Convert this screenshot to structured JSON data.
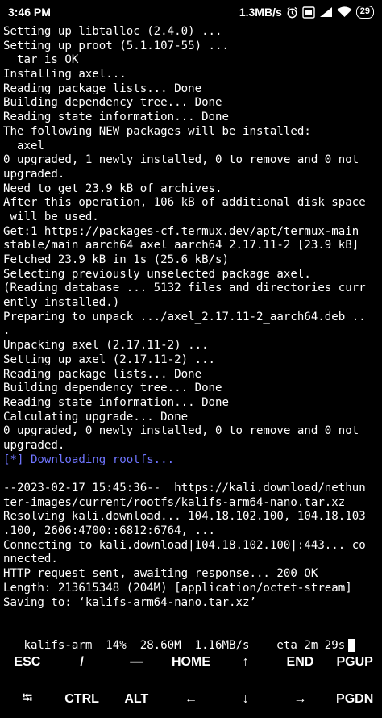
{
  "status_bar": {
    "time": "3:46 PM",
    "speed": "1.3MB/s",
    "battery": "29",
    "icons": [
      "alarm-icon",
      "volte-icon",
      "signal-icon",
      "wifi-icon",
      "battery-icon"
    ]
  },
  "terminal": {
    "lines": [
      {
        "text": "Setting up libtalloc (2.4.0) ..."
      },
      {
        "text": "Setting up proot (5.1.107-55) ..."
      },
      {
        "text": "  tar is OK"
      },
      {
        "text": "Installing axel..."
      },
      {
        "text": "Reading package lists... Done"
      },
      {
        "text": "Building dependency tree... Done"
      },
      {
        "text": "Reading state information... Done"
      },
      {
        "text": "The following NEW packages will be installed:"
      },
      {
        "text": "  axel"
      },
      {
        "text": "0 upgraded, 1 newly installed, 0 to remove and 0 not"
      },
      {
        "text": "upgraded."
      },
      {
        "text": "Need to get 23.9 kB of archives."
      },
      {
        "text": "After this operation, 106 kB of additional disk space"
      },
      {
        "text": " will be used."
      },
      {
        "text": "Get:1 https://packages-cf.termux.dev/apt/termux-main"
      },
      {
        "text": "stable/main aarch64 axel aarch64 2.17.11-2 [23.9 kB]"
      },
      {
        "text": "Fetched 23.9 kB in 1s (25.6 kB/s)"
      },
      {
        "text": "Selecting previously unselected package axel."
      },
      {
        "text": "(Reading database ... 5132 files and directories curr"
      },
      {
        "text": "ently installed.)"
      },
      {
        "text": "Preparing to unpack .../axel_2.17.11-2_aarch64.deb .."
      },
      {
        "text": "."
      },
      {
        "text": "Unpacking axel (2.17.11-2) ..."
      },
      {
        "text": "Setting up axel (2.17.11-2) ..."
      },
      {
        "text": "Reading package lists... Done"
      },
      {
        "text": "Building dependency tree... Done"
      },
      {
        "text": "Reading state information... Done"
      },
      {
        "text": "Calculating upgrade... Done"
      },
      {
        "text": "0 upgraded, 0 newly installed, 0 to remove and 0 not"
      },
      {
        "text": "upgraded."
      },
      {
        "text": "[*] Downloading rootfs...",
        "color": "blue"
      },
      {
        "text": ""
      },
      {
        "text": "--2023-02-17 15:45:36--  https://kali.download/nethun"
      },
      {
        "text": "ter-images/current/rootfs/kalifs-arm64-nano.tar.xz"
      },
      {
        "text": "Resolving kali.download... 104.18.102.100, 104.18.103"
      },
      {
        "text": ".100, 2606:4700::6812:6764, ..."
      },
      {
        "text": "Connecting to kali.download|104.18.102.100|:443... co"
      },
      {
        "text": "nnected."
      },
      {
        "text": "HTTP request sent, awaiting response... 200 OK"
      },
      {
        "text": "Length: 213615348 (204M) [application/octet-stream]"
      },
      {
        "text": "Saving to: ‘kalifs-arm64-nano.tar.xz’"
      },
      {
        "text": ""
      },
      {
        "text": ""
      }
    ],
    "progress": {
      "text": "   kalifs-arm  14%  28.60M  1.16MB/s    eta 2m 29s",
      "percent": 14
    }
  },
  "extra_keys": {
    "row1": [
      "ESC",
      "/",
      "—",
      "HOME",
      "↑",
      "END",
      "PGUP"
    ],
    "row2": [
      "⭾",
      "CTRL",
      "ALT",
      "←",
      "↓",
      "→",
      "PGDN"
    ]
  },
  "colors": {
    "background": "#000000",
    "foreground": "#ffffff",
    "accent_blue": "#6f75ff"
  }
}
